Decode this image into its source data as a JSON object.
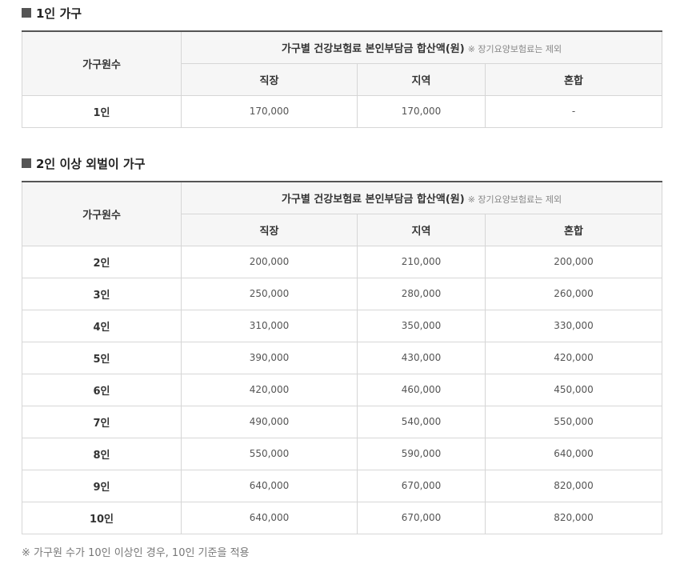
{
  "section1": {
    "title": "1인 가구",
    "header": {
      "household_col": "가구원수",
      "group_label": "가구별 건강보험료 본인부담금 합산액(원)",
      "group_note": "※ 장기요양보험료는 제외",
      "cols": [
        "직장",
        "지역",
        "혼합"
      ]
    },
    "rows": [
      {
        "label": "1인",
        "values": [
          "170,000",
          "170,000",
          "-"
        ]
      }
    ]
  },
  "section2": {
    "title": "2인 이상 외벌이 가구",
    "header": {
      "household_col": "가구원수",
      "group_label": "가구별 건강보험료 본인부담금 합산액(원)",
      "group_note": "※ 장기요양보험료는 제외",
      "cols": [
        "직장",
        "지역",
        "혼합"
      ]
    },
    "rows": [
      {
        "label": "2인",
        "values": [
          "200,000",
          "210,000",
          "200,000"
        ]
      },
      {
        "label": "3인",
        "values": [
          "250,000",
          "280,000",
          "260,000"
        ]
      },
      {
        "label": "4인",
        "values": [
          "310,000",
          "350,000",
          "330,000"
        ]
      },
      {
        "label": "5인",
        "values": [
          "390,000",
          "430,000",
          "420,000"
        ]
      },
      {
        "label": "6인",
        "values": [
          "420,000",
          "460,000",
          "450,000"
        ]
      },
      {
        "label": "7인",
        "values": [
          "490,000",
          "540,000",
          "550,000"
        ]
      },
      {
        "label": "8인",
        "values": [
          "550,000",
          "590,000",
          "640,000"
        ]
      },
      {
        "label": "9인",
        "values": [
          "640,000",
          "670,000",
          "820,000"
        ]
      },
      {
        "label": "10인",
        "values": [
          "640,000",
          "670,000",
          "820,000"
        ]
      }
    ]
  },
  "footnote": "※ 가구원 수가 10인 이상인 경우, 10인 기준을 적용"
}
